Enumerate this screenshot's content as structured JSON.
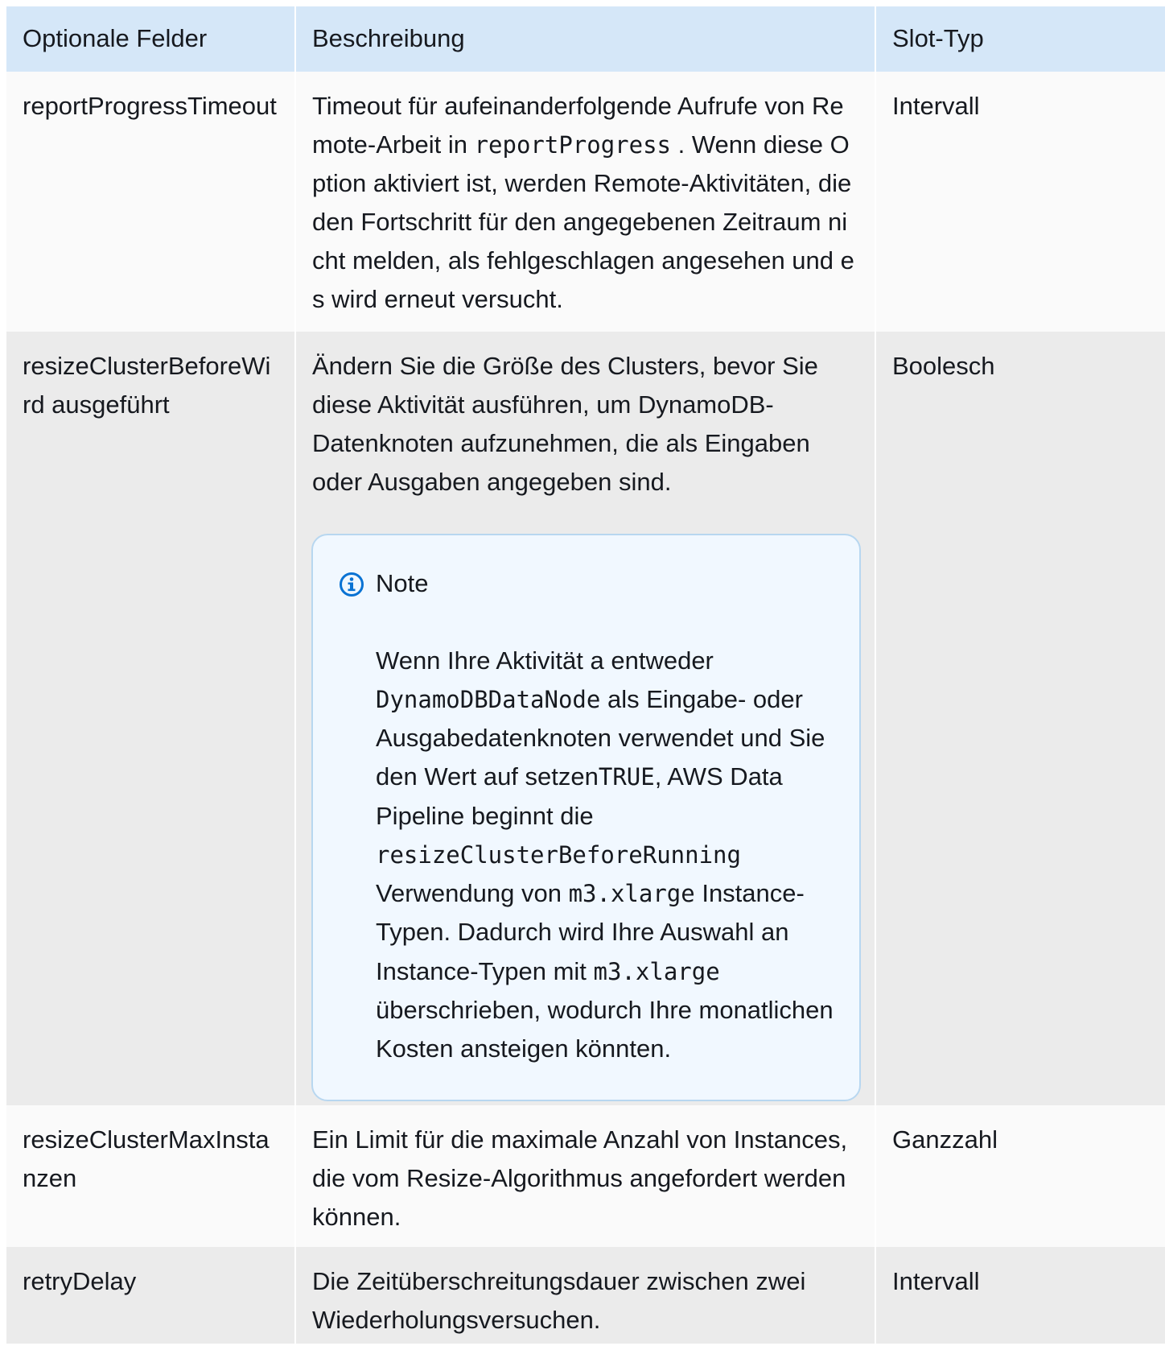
{
  "table": {
    "headers": [
      "Optionale Felder",
      "Beschreibung",
      "Slot-Typ"
    ],
    "rows": [
      {
        "field": "reportProgressTimeout",
        "description": {
          "before": "Timeout für aufeinanderfolgende Aufrufe von Remote-Arbeit in ",
          "code": "reportProgress",
          "after": " . Wenn diese Option aktiviert ist, werden Remote-Aktivitäten, die den Fortschritt für den angegebenen Zeitraum nicht melden, als fehlgeschlagen angesehen und es wird erneut versucht."
        },
        "type": "Intervall"
      },
      {
        "field": "resizeClusterBeforeWird ausgeführt",
        "description": "Ändern Sie die Größe des Clusters, bevor Sie diese Aktivität ausführen, um DynamoDB-Datenknoten aufzunehmen, die als Eingaben oder Ausgaben angegeben sind.",
        "type": "Boolesch",
        "note": {
          "title": "Note",
          "icon": "info-circle-icon",
          "text1": "Wenn Ihre Aktivität a entweder ",
          "code1": "DynamoDBDataNode",
          "text2": " als Eingabe- oder Ausgabedatenknoten verwendet und Sie den Wert auf setzen",
          "code2": "TRUE",
          "text3": ", AWS Data Pipeline beginnt die ",
          "code3": "resizeClusterBeforeRunning",
          "text4": " Verwendung von ",
          "code4": "m3.xlarge",
          "text5": " Instance-Typen. Dadurch wird Ihre Auswahl an Instance-Typen mit ",
          "code5": "m3.xlarge",
          "text6": " überschrieben, wodurch Ihre monatlichen Kosten ansteigen könnten."
        }
      },
      {
        "field": "resizeClusterMaxInstanzen",
        "description": "Ein Limit für die maximale Anzahl von Instances, die vom Resize-Algorithmus angefordert werden können.",
        "type": "Ganzzahl"
      },
      {
        "field": "retryDelay",
        "description": "Die Zeitüberschreitungsdauer zwischen zwei Wiederholungsversuchen.",
        "type": "Intervall"
      }
    ]
  },
  "colors": {
    "header_bg": "#d5e7f8",
    "row_light": "#fafafa",
    "row_dark": "#ebebeb",
    "note_bg": "#f1f8ff",
    "note_border": "#b8d7f0",
    "info_blue": "#0972d3"
  }
}
